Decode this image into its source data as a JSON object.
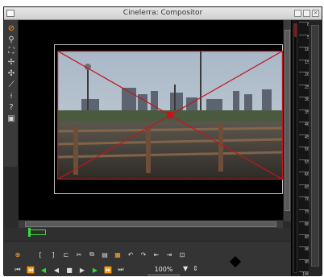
{
  "window": {
    "title": "Cinelerra: Compositor"
  },
  "titlebar": {
    "close_glyph": "×"
  },
  "left_tools": [
    {
      "icon": "protect-icon",
      "glyph": "⊘"
    },
    {
      "icon": "zoom-icon",
      "glyph": "⚲"
    },
    {
      "icon": "mask-icon",
      "glyph": "⛶"
    },
    {
      "icon": "camera-icon",
      "glyph": "✢"
    },
    {
      "icon": "projector-icon",
      "glyph": "✣"
    },
    {
      "icon": "crop-icon",
      "glyph": "⟋"
    },
    {
      "icon": "eyedropper-icon",
      "glyph": "⟊"
    },
    {
      "icon": "help-icon",
      "glyph": "?"
    },
    {
      "icon": "safe-regions-icon",
      "glyph": "▣"
    }
  ],
  "meter": {
    "ticks": [
      "0",
      "5",
      "10",
      "15",
      "20",
      "25",
      "30",
      "35",
      "40",
      "45",
      "50",
      "55",
      "60",
      "65",
      "70",
      "75",
      "80",
      "85",
      "90",
      "95",
      "100"
    ]
  },
  "edit_buttons": [
    {
      "icon": "label-icon",
      "glyph": "⊕",
      "color": "#ffab3b"
    },
    {
      "icon": "in-point-icon",
      "glyph": "["
    },
    {
      "icon": "out-point-icon",
      "glyph": "]"
    },
    {
      "icon": "splice-icon",
      "glyph": "⊏"
    },
    {
      "icon": "cut-icon",
      "glyph": "✂"
    },
    {
      "icon": "copy-icon",
      "glyph": "⧉"
    },
    {
      "icon": "paste-icon",
      "glyph": "▤"
    },
    {
      "icon": "overwrite-icon",
      "glyph": "▦",
      "color": "#ffab3b"
    },
    {
      "icon": "undo-icon",
      "glyph": "↶"
    },
    {
      "icon": "redo-icon",
      "glyph": "↷"
    },
    {
      "icon": "prev-label-icon",
      "glyph": "⇤"
    },
    {
      "icon": "next-label-icon",
      "glyph": "⇥"
    },
    {
      "icon": "toclip-icon",
      "glyph": "⊡"
    }
  ],
  "transport_buttons": [
    {
      "icon": "rewind-icon",
      "glyph": "⏮",
      "color": "#dcdcdc"
    },
    {
      "icon": "fast-reverse-icon",
      "glyph": "⏪",
      "color": "#2ee02e"
    },
    {
      "icon": "reverse-icon",
      "glyph": "◀",
      "color": "#2ee02e"
    },
    {
      "icon": "frame-back-icon",
      "glyph": "◀",
      "color": "#dcdcdc"
    },
    {
      "icon": "stop-icon",
      "glyph": "■",
      "color": "#dcdcdc"
    },
    {
      "icon": "frame-forward-icon",
      "glyph": "▶",
      "color": "#dcdcdc"
    },
    {
      "icon": "play-icon",
      "glyph": "▶",
      "color": "#2ee02e"
    },
    {
      "icon": "fast-forward-icon",
      "glyph": "⏩",
      "color": "#2ee02e"
    },
    {
      "icon": "end-icon",
      "glyph": "⏭",
      "color": "#dcdcdc"
    }
  ],
  "zoom": {
    "value": "100%",
    "arrow": "▼",
    "spin": "⇕"
  },
  "colors": {
    "overlay": "#c0161c",
    "accent": "#ff9a2e",
    "green": "#2ee02e"
  }
}
